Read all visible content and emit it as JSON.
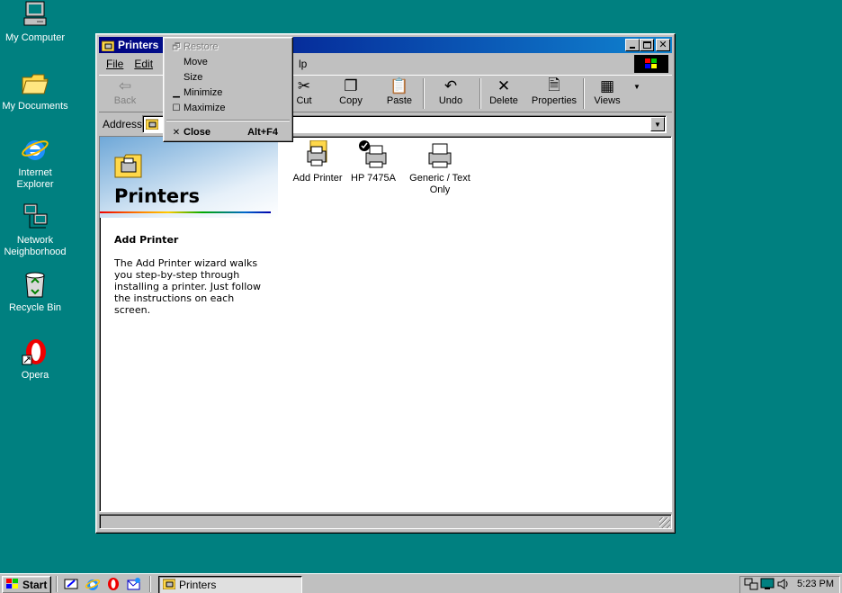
{
  "desktop": {
    "icons": [
      {
        "label": "My Computer"
      },
      {
        "label": "My Documents"
      },
      {
        "label": "Internet Explorer"
      },
      {
        "label": "Network Neighborhood"
      },
      {
        "label": "Recycle Bin"
      },
      {
        "label": "Opera"
      }
    ]
  },
  "window": {
    "title": "Printers",
    "menu": [
      "File",
      "Edit",
      "lp"
    ],
    "toolbar": {
      "back": "Back",
      "cut": "Cut",
      "copy": "Copy",
      "paste": "Paste",
      "undo": "Undo",
      "delete": "Delete",
      "properties": "Properties",
      "views": "Views"
    },
    "address_label": "Address",
    "left_pane": {
      "title": "Printers",
      "heading": "Add Printer",
      "description": "The Add Printer wizard walks you step-by-step through installing a printer. Just follow the instructions on each screen."
    },
    "items": [
      {
        "label": "Add Printer",
        "icon": "add-printer-icon"
      },
      {
        "label": "HP 7475A",
        "icon": "default-printer-icon"
      },
      {
        "label": "Generic / Text Only",
        "icon": "printer-icon"
      }
    ]
  },
  "system_menu": {
    "items": [
      {
        "label": "Restore",
        "enabled": false
      },
      {
        "label": "Move",
        "enabled": true
      },
      {
        "label": "Size",
        "enabled": true
      },
      {
        "label": "Minimize",
        "enabled": true
      },
      {
        "label": "Maximize",
        "enabled": true
      },
      {
        "label": "Close",
        "shortcut": "Alt+F4",
        "enabled": true
      }
    ]
  },
  "taskbar": {
    "start": "Start",
    "task": "Printers",
    "clock": "5:23 PM"
  },
  "colors": {
    "desktop": "#008080",
    "titlebar": "#000080",
    "face": "#c0c0c0"
  }
}
